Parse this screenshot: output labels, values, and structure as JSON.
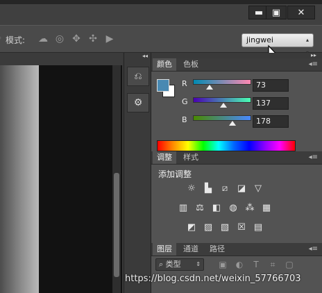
{
  "window": {
    "controls": [
      {
        "name": "minimize-button",
        "glyph": "▬"
      },
      {
        "name": "maximize-button",
        "glyph": "▣"
      },
      {
        "name": "close-button",
        "glyph": "✕"
      }
    ]
  },
  "options_bar": {
    "mode_label": "模式:",
    "icons": [
      "orbit-3d-icon",
      "roll-3d-icon",
      "drag-3d-icon",
      "slide-3d-icon",
      "camera-3d-icon"
    ],
    "workspace_value": "jingwei"
  },
  "collapse_column": {
    "collapse_arrow": "◂◂",
    "expand_arrow": "▸▸",
    "icons": [
      "history-icon",
      "tool-presets-icon"
    ]
  },
  "color_panel": {
    "tabs": [
      "颜色",
      "色板"
    ],
    "channels": [
      {
        "label": "R",
        "value": "73"
      },
      {
        "label": "G",
        "value": "137"
      },
      {
        "label": "B",
        "value": "178"
      }
    ],
    "foreground_color": "#4989b2",
    "background_color": "#ffffff"
  },
  "adjustments_panel": {
    "tabs": [
      "调整",
      "样式"
    ],
    "heading": "添加调整",
    "rows": [
      [
        "brightness-contrast-icon",
        "levels-icon",
        "curves-icon",
        "exposure-icon",
        "vibrance-icon"
      ],
      [
        "hue-saturation-icon",
        "color-balance-icon",
        "black-white-icon",
        "photo-filter-icon",
        "channel-mixer-icon",
        "color-lookup-icon"
      ],
      [
        "invert-icon",
        "posterize-icon",
        "threshold-icon",
        "selective-color-icon",
        "gradient-map-icon"
      ]
    ]
  },
  "layers_panel": {
    "tabs": [
      "图层",
      "通道",
      "路径"
    ],
    "filter_value": "类型",
    "filter_icons": [
      "pixel-filter-icon",
      "adjustment-filter-icon",
      "type-filter-icon",
      "shape-filter-icon",
      "smart-object-filter-icon"
    ]
  },
  "watermark": "https://blog.csdn.net/weixin_57766703"
}
